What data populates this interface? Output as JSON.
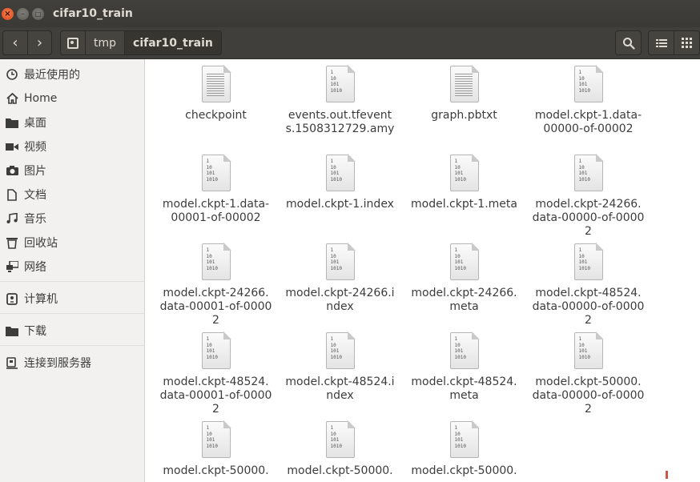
{
  "window": {
    "title": "cifar10_train",
    "close_label": "×",
    "min_label": "–",
    "max_label": "□"
  },
  "toolbar": {
    "back_label": "‹",
    "forward_label": "›",
    "breadcrumb": [
      "tmp",
      "cifar10_train"
    ]
  },
  "sidebar": {
    "items": [
      {
        "label": "最近使用的",
        "icon": "clock-icon"
      },
      {
        "label": "Home",
        "icon": "home-icon"
      },
      {
        "label": "桌面",
        "icon": "folder-icon"
      },
      {
        "label": "视频",
        "icon": "video-icon"
      },
      {
        "label": "图片",
        "icon": "camera-icon"
      },
      {
        "label": "文档",
        "icon": "document-icon"
      },
      {
        "label": "音乐",
        "icon": "music-icon"
      },
      {
        "label": "回收站",
        "icon": "trash-icon"
      },
      {
        "label": "网络",
        "icon": "network-icon"
      },
      {
        "label": "计算机",
        "icon": "computer-icon"
      },
      {
        "label": "下载",
        "icon": "folder-icon"
      },
      {
        "label": "连接到服务器",
        "icon": "server-icon"
      }
    ]
  },
  "files": [
    {
      "name": "checkpoint",
      "type": "text"
    },
    {
      "name": "events.out.tfevents.1508312729.amy",
      "type": "binary"
    },
    {
      "name": "graph.pbtxt",
      "type": "text"
    },
    {
      "name": "model.ckpt-1.data-00000-of-00002",
      "type": "binary"
    },
    {
      "name": "model.ckpt-1.data-00001-of-00002",
      "type": "binary"
    },
    {
      "name": "model.ckpt-1.index",
      "type": "binary"
    },
    {
      "name": "model.ckpt-1.meta",
      "type": "binary"
    },
    {
      "name": "model.ckpt-24266.data-00000-of-00002",
      "type": "binary"
    },
    {
      "name": "model.ckpt-24266.data-00001-of-00002",
      "type": "binary"
    },
    {
      "name": "model.ckpt-24266.index",
      "type": "binary"
    },
    {
      "name": "model.ckpt-24266.meta",
      "type": "binary"
    },
    {
      "name": "model.ckpt-48524.data-00000-of-00002",
      "type": "binary"
    },
    {
      "name": "model.ckpt-48524.data-00001-of-00002",
      "type": "binary"
    },
    {
      "name": "model.ckpt-48524.index",
      "type": "binary"
    },
    {
      "name": "model.ckpt-48524.meta",
      "type": "binary"
    },
    {
      "name": "model.ckpt-50000.data-00000-of-00002",
      "type": "binary"
    },
    {
      "name": "model.ckpt-50000.",
      "type": "binary"
    },
    {
      "name": "model.ckpt-50000.",
      "type": "binary"
    },
    {
      "name": "model.ckpt-50000.",
      "type": "binary"
    }
  ],
  "file_icon_binary_text": [
    "1",
    "10",
    "101",
    "1010"
  ],
  "colors": {
    "titlebar": "#3c3b37",
    "close_button": "#df4a16",
    "sidebar": "#f2f1f0"
  }
}
